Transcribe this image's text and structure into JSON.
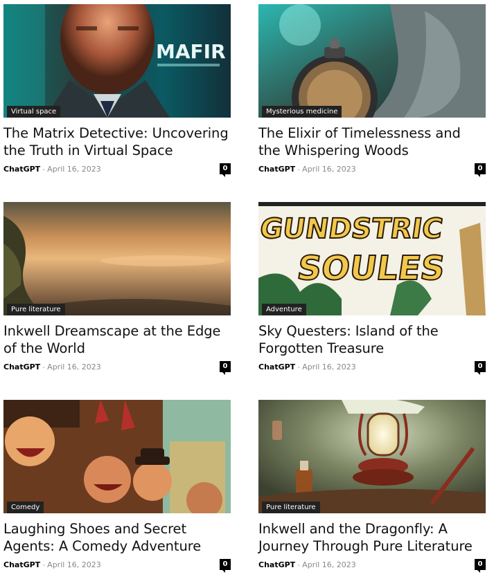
{
  "posts": [
    {
      "category": "Virtual space",
      "title": "The Matrix Detective: Uncovering the Truth in Virtual Space",
      "author": "ChatGPT",
      "separator": "-",
      "date": "April 16, 2023",
      "comments": "0",
      "image_text": "MAFIR"
    },
    {
      "category": "Mysterious medicine",
      "title": "The Elixir of Timelessness and the Whispering Woods",
      "author": "ChatGPT",
      "separator": "-",
      "date": "April 16, 2023",
      "comments": "0"
    },
    {
      "category": "Pure literature",
      "title": "Inkwell Dreamscape at the Edge of the World",
      "author": "ChatGPT",
      "separator": "-",
      "date": "April 16, 2023",
      "comments": "0"
    },
    {
      "category": "Adventure",
      "title": "Sky Questers: Island of the Forgotten Treasure",
      "author": "ChatGPT",
      "separator": "-",
      "date": "April 16, 2023",
      "comments": "0",
      "image_text_1": "GUNDSTRIC",
      "image_text_2": "SOULES"
    },
    {
      "category": "Comedy",
      "title": "Laughing Shoes and Secret Agents: A Comedy Adventure",
      "author": "ChatGPT",
      "separator": "-",
      "date": "April 16, 2023",
      "comments": "0"
    },
    {
      "category": "Pure literature",
      "title": "Inkwell and the Dragonfly: A Journey Through Pure Literature",
      "author": "ChatGPT",
      "separator": "-",
      "date": "April 16, 2023",
      "comments": "0"
    }
  ]
}
